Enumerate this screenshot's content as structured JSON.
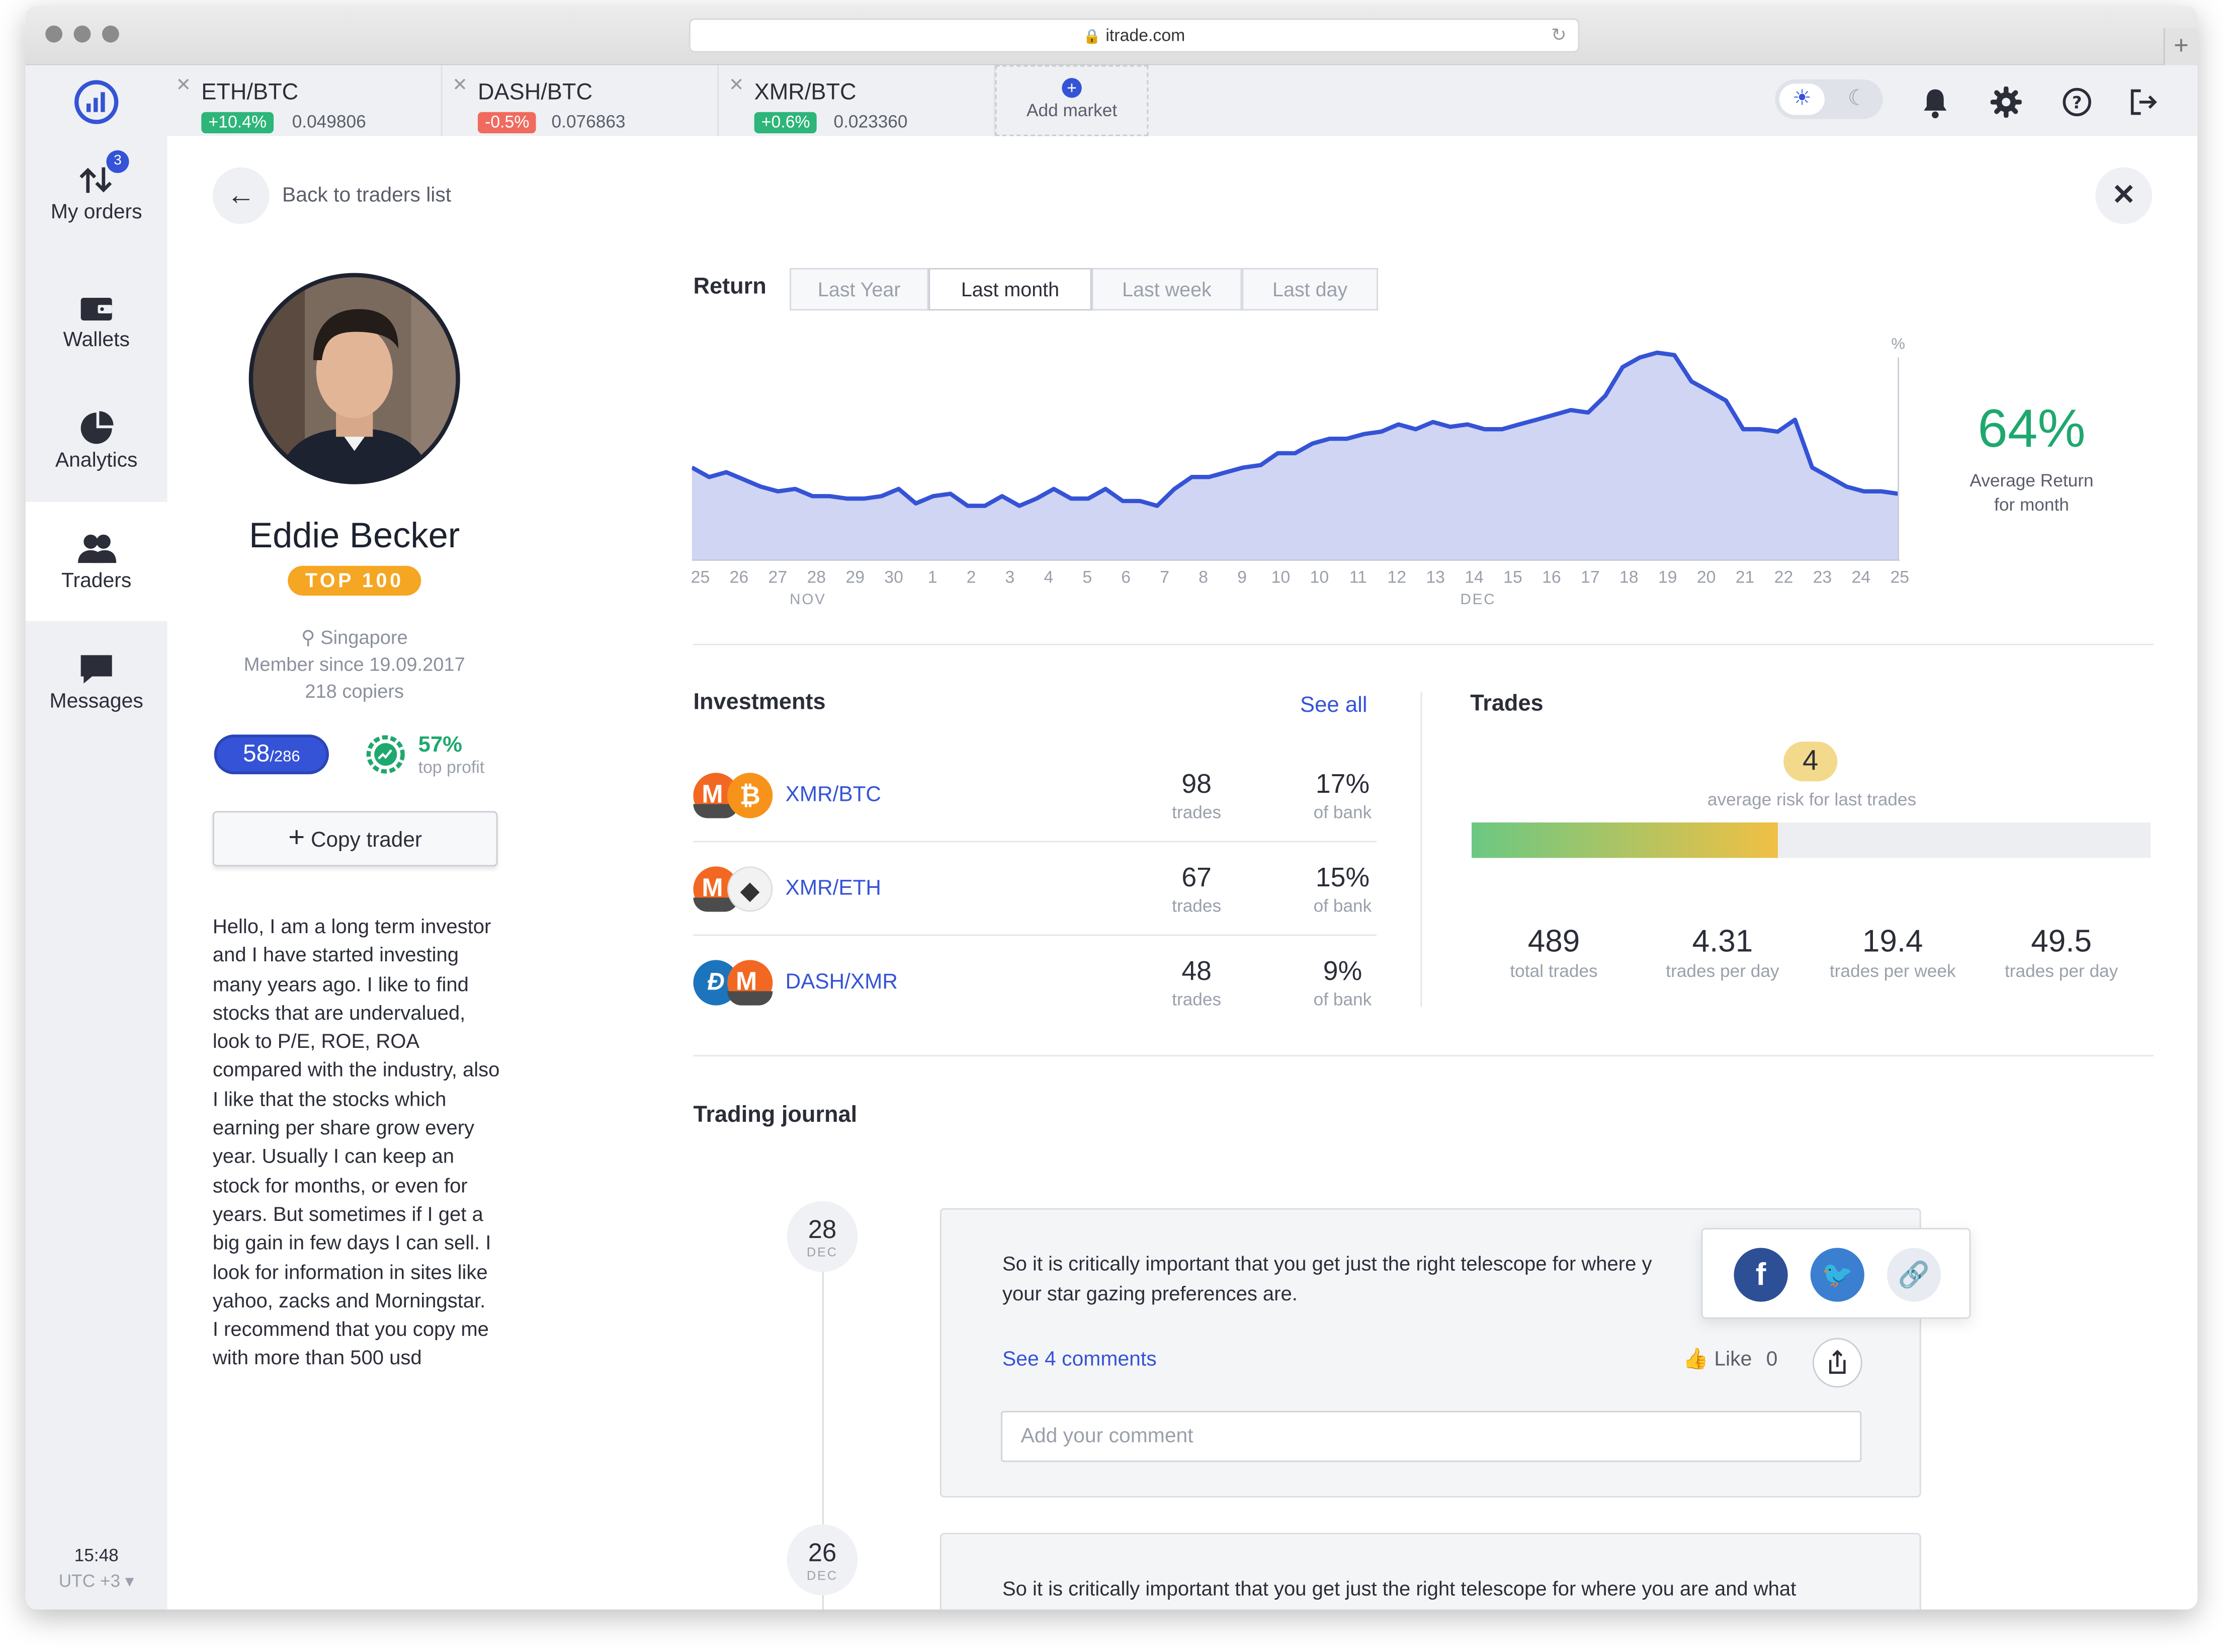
{
  "browser": {
    "url": "itrade.com"
  },
  "tabs": [
    {
      "pair": "ETH/BTC",
      "change": "+10.4%",
      "price": "0.049806",
      "color": "#2db57a"
    },
    {
      "pair": "DASH/BTC",
      "change": "-0.5%",
      "price": "0.076863",
      "color": "#f06a5e"
    },
    {
      "pair": "XMR/BTC",
      "change": "+0.6%",
      "price": "0.023360",
      "color": "#2db57a"
    }
  ],
  "add_market": "Add market",
  "nav": {
    "orders": "My orders",
    "orders_badge": "3",
    "wallets": "Wallets",
    "analytics": "Analytics",
    "traders": "Traders",
    "messages": "Messages"
  },
  "clock": {
    "time": "15:48",
    "tz": "UTC +3 ▾"
  },
  "back": "Back to traders list",
  "profile": {
    "name": "Eddie Becker",
    "rank": "TOP 100",
    "location": "Singapore",
    "member_since": "Member since 19.09.2017",
    "copiers": "218 copiers",
    "rank_pos": "58",
    "rank_total": "/286",
    "profit": "57%",
    "profit_label": "top profit",
    "copy_button": "Copy trader",
    "bio": "Hello, I am a long term investor and I have started investing many years ago. I like to find stocks that are undervalued,  look to P/E, ROE, ROA compared with the industry, also I like that the stocks which earning per share grow every year. Usually I can keep an stock for months, or even for years. But sometimes if I get a big gain in few days I can sell.  I look for information in sites like yahoo, zacks and Morningstar.\nI recommend that you copy me with more than 500 usd"
  },
  "return": {
    "label": "Return",
    "periods": [
      "Last Year",
      "Last month",
      "Last week",
      "Last day"
    ],
    "selected": "Last month",
    "avg_value": "64%",
    "avg_label1": "Average Return",
    "avg_label2": "for month"
  },
  "chart_data": {
    "type": "area",
    "y_unit": "%",
    "x": [
      "25",
      "26",
      "27",
      "28",
      "29",
      "30",
      "1",
      "2",
      "3",
      "4",
      "5",
      "6",
      "7",
      "8",
      "9",
      "10",
      "10",
      "11",
      "12",
      "13",
      "14",
      "15",
      "16",
      "17",
      "18",
      "19",
      "20",
      "21",
      "22",
      "23",
      "24",
      "25"
    ],
    "month_labels": [
      "NOV",
      "DEC"
    ],
    "grid": false,
    "color": "#3553d6",
    "fill": "#cfd5f3",
    "values": [
      17,
      15,
      16,
      14.5,
      13,
      12,
      12.5,
      11,
      11,
      10.5,
      10.5,
      11,
      12.5,
      9.5,
      11,
      11.5,
      9,
      9,
      11,
      9,
      10.5,
      12.5,
      10.5,
      10.5,
      12.5,
      10,
      10,
      9,
      12.5,
      15,
      15,
      16,
      17,
      17.5,
      20,
      20,
      22,
      23,
      23,
      24,
      24.5,
      26,
      25,
      26.5,
      25.5,
      26,
      25,
      25,
      26,
      27,
      28,
      29,
      28.5,
      32,
      38,
      40,
      41,
      40.5,
      35,
      33,
      31,
      25,
      25,
      24.5,
      27,
      17,
      15,
      13,
      12,
      12,
      11.5
    ]
  },
  "investments": {
    "title": "Investments",
    "see_all": "See all",
    "rows": [
      {
        "pair": "XMR/BTC",
        "trades": "98",
        "trades_label": "trades",
        "bank": "17%",
        "bank_label": "of bank",
        "c1": "#f26822",
        "c2": "#f7931a"
      },
      {
        "pair": "XMR/ETH",
        "trades": "67",
        "trades_label": "trades",
        "bank": "15%",
        "bank_label": "of bank",
        "c1": "#f26822",
        "c2": "#f2f2f2"
      },
      {
        "pair": "DASH/XMR",
        "trades": "48",
        "trades_label": "trades",
        "bank": "9%",
        "bank_label": "of bank",
        "c1": "#1c75bc",
        "c2": "#f26822"
      }
    ]
  },
  "trades": {
    "title": "Trades",
    "risk": "4",
    "risk_label": "average risk for last trades",
    "risk_fill": 0.45,
    "stats": [
      {
        "value": "489",
        "label": "total trades"
      },
      {
        "value": "4.31",
        "label": "trades per day"
      },
      {
        "value": "19.4",
        "label": "trades per week"
      },
      {
        "value": "49.5",
        "label": "trades per day"
      }
    ]
  },
  "journal": {
    "title": "Trading journal",
    "entries": [
      {
        "day": "28",
        "month": "DEC",
        "text1": "So it is critically important that you get just the right telescope for where y",
        "text2": "your star gazing preferences are.",
        "comments": "See 4 comments",
        "like": "Like",
        "likes": "0",
        "placeholder": "Add your comment"
      },
      {
        "day": "26",
        "month": "DEC",
        "text1": "So it is critically important that you get just the right telescope for where you are and what"
      }
    ]
  }
}
